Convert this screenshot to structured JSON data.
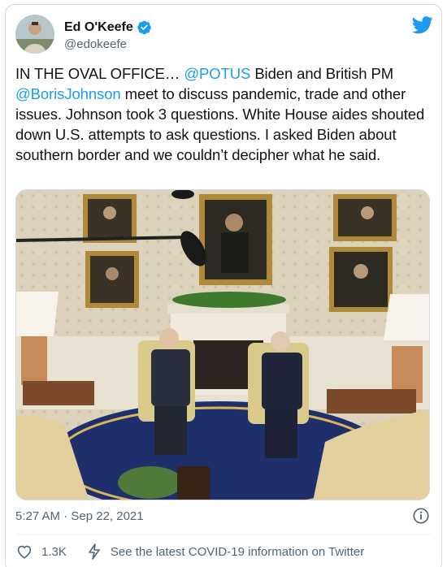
{
  "author": {
    "display_name": "Ed O'Keefe",
    "handle": "@edokeefe",
    "verified": true
  },
  "tweet": {
    "text_parts": [
      {
        "type": "text",
        "value": "IN THE OVAL OFFICE… "
      },
      {
        "type": "mention",
        "value": "@POTUS"
      },
      {
        "type": "text",
        "value": " Biden and British PM "
      },
      {
        "type": "mention",
        "value": "@BorisJohnson"
      },
      {
        "type": "text",
        "value": " meet to discuss pandemic, trade and other issues. Johnson took 3 questions. White House aides shouted down U.S. attempts to ask questions. I asked Biden about southern border and we couldn’t decipher what he said."
      }
    ]
  },
  "media": {
    "icon": "oval-office-photo"
  },
  "meta": {
    "timestamp": "5:27 AM · Sep 22, 2021"
  },
  "actions": {
    "like_count": "1.3K",
    "covid_info": "See the latest COVID-19 information on Twitter"
  },
  "colors": {
    "brand": "#1d9bf0",
    "text": "#0f1419",
    "secondary": "#536471",
    "border": "#cfd9de"
  }
}
